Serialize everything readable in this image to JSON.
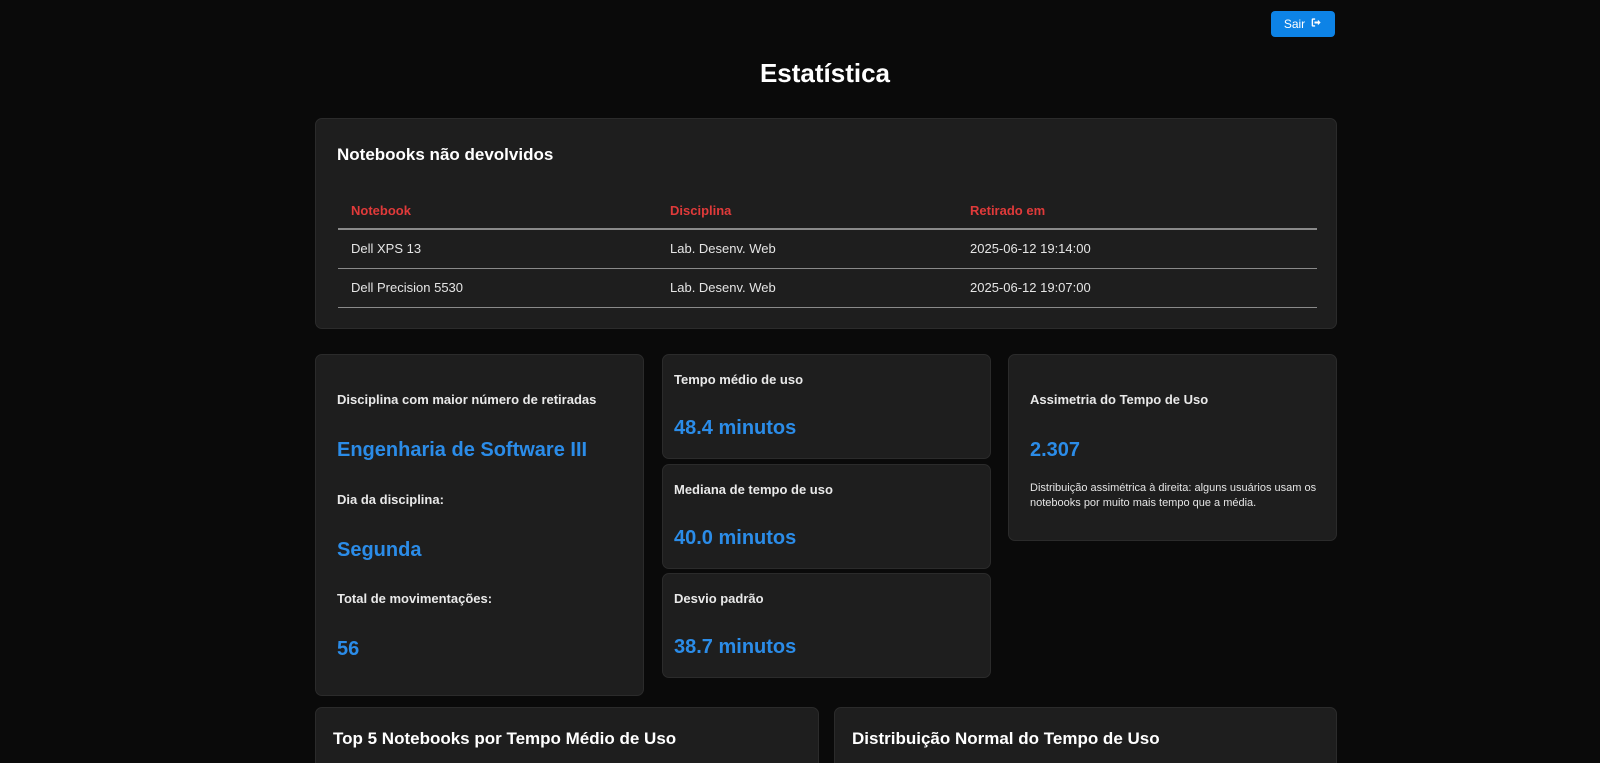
{
  "header": {
    "logout_label": "Sair",
    "page_title": "Estatística"
  },
  "unreturned": {
    "title": "Notebooks não devolvidos",
    "columns": [
      "Notebook",
      "Disciplina",
      "Retirado em"
    ],
    "rows": [
      [
        "Dell XPS 13",
        "Lab. Desenv. Web",
        "2025-06-12 19:14:00"
      ],
      [
        "Dell Precision 5530",
        "Lab. Desenv. Web",
        "2025-06-12 19:07:00"
      ]
    ]
  },
  "discipline": {
    "top_label": "Disciplina com maior número de retiradas",
    "top_value": "Engenharia de Software III",
    "day_label": "Dia da disciplina:",
    "day_value": "Segunda",
    "total_label": "Total de movimentações:",
    "total_value": "56"
  },
  "stats": {
    "mean_label": "Tempo médio de uso",
    "mean_value": "48.4 minutos",
    "median_label": "Mediana de tempo de uso",
    "median_value": "40.0 minutos",
    "std_label": "Desvio padrão",
    "std_value": "38.7 minutos"
  },
  "skewness": {
    "label": "Assimetria do Tempo de Uso",
    "value": "2.307",
    "description": "Distribuição assimétrica à direita: alguns usuários usam os notebooks por muito mais tempo que a média."
  },
  "charts": {
    "top5_title": "Top 5 Notebooks por Tempo Médio de Uso",
    "distribution_title": "Distribuição Normal do Tempo de Uso"
  },
  "colors": {
    "background": "#0a0a0a",
    "card": "#1e1e1e",
    "accent_blue": "#2b8ce8",
    "table_header_red": "#e03a3a",
    "button_blue": "#0d83e6"
  },
  "icons": {
    "logout": "sign-out-icon"
  }
}
